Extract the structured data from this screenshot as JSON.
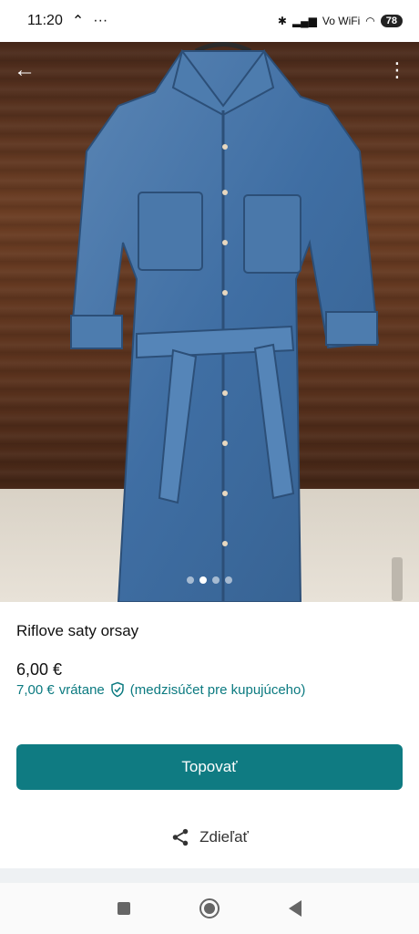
{
  "status_bar": {
    "time": "11:20",
    "battery": "78",
    "vowifi": "Vo WiFi"
  },
  "listing": {
    "title": "Riflove saty orsay",
    "price": "6,00 €",
    "buyer_price": "7,00 €",
    "buyer_including": "vrátane",
    "buyer_note": "(medzisúčet pre kupujúceho)"
  },
  "gallery": {
    "image_count": 4,
    "active_index": 1
  },
  "actions": {
    "promote_label": "Topovať",
    "share_label": "Zdieľať"
  },
  "colors": {
    "accent": "#0f7b82",
    "accent_text": "#0b7a80"
  },
  "icons": {
    "back": "arrow-left-icon",
    "more": "more-vertical-icon",
    "shield": "shield-check-icon",
    "share": "share-icon"
  }
}
